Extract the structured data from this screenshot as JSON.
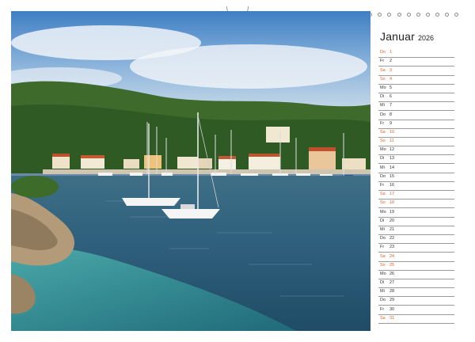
{
  "calendar": {
    "month": "Januar",
    "year": "2026",
    "days": [
      {
        "wd": "Do",
        "num": "1",
        "weekend": true
      },
      {
        "wd": "Fr",
        "num": "2",
        "weekend": false
      },
      {
        "wd": "Sa",
        "num": "3",
        "weekend": true
      },
      {
        "wd": "So",
        "num": "4",
        "weekend": true
      },
      {
        "wd": "Mo",
        "num": "5",
        "weekend": false
      },
      {
        "wd": "Di",
        "num": "6",
        "weekend": false
      },
      {
        "wd": "Mi",
        "num": "7",
        "weekend": false
      },
      {
        "wd": "Do",
        "num": "8",
        "weekend": false
      },
      {
        "wd": "Fr",
        "num": "9",
        "weekend": false
      },
      {
        "wd": "Sa",
        "num": "10",
        "weekend": true
      },
      {
        "wd": "So",
        "num": "11",
        "weekend": true
      },
      {
        "wd": "Mo",
        "num": "12",
        "weekend": false
      },
      {
        "wd": "Di",
        "num": "13",
        "weekend": false
      },
      {
        "wd": "Mi",
        "num": "14",
        "weekend": false
      },
      {
        "wd": "Do",
        "num": "15",
        "weekend": false
      },
      {
        "wd": "Fr",
        "num": "16",
        "weekend": false
      },
      {
        "wd": "Sa",
        "num": "17",
        "weekend": true
      },
      {
        "wd": "So",
        "num": "18",
        "weekend": true
      },
      {
        "wd": "Mo",
        "num": "19",
        "weekend": false
      },
      {
        "wd": "Di",
        "num": "20",
        "weekend": false
      },
      {
        "wd": "Mi",
        "num": "21",
        "weekend": false
      },
      {
        "wd": "Do",
        "num": "22",
        "weekend": false
      },
      {
        "wd": "Fr",
        "num": "23",
        "weekend": false
      },
      {
        "wd": "Sa",
        "num": "24",
        "weekend": true
      },
      {
        "wd": "So",
        "num": "25",
        "weekend": true
      },
      {
        "wd": "Mo",
        "num": "26",
        "weekend": false
      },
      {
        "wd": "Di",
        "num": "27",
        "weekend": false
      },
      {
        "wd": "Mi",
        "num": "28",
        "weekend": false
      },
      {
        "wd": "Do",
        "num": "29",
        "weekend": false
      },
      {
        "wd": "Fr",
        "num": "30",
        "weekend": false
      },
      {
        "wd": "Sa",
        "num": "31",
        "weekend": true
      }
    ]
  },
  "colors": {
    "weekend": "#e0652d",
    "weekday": "#333333",
    "rule": "#9a9a9a"
  },
  "photo": {
    "subject": "harbor-with-sailboats-icon"
  }
}
